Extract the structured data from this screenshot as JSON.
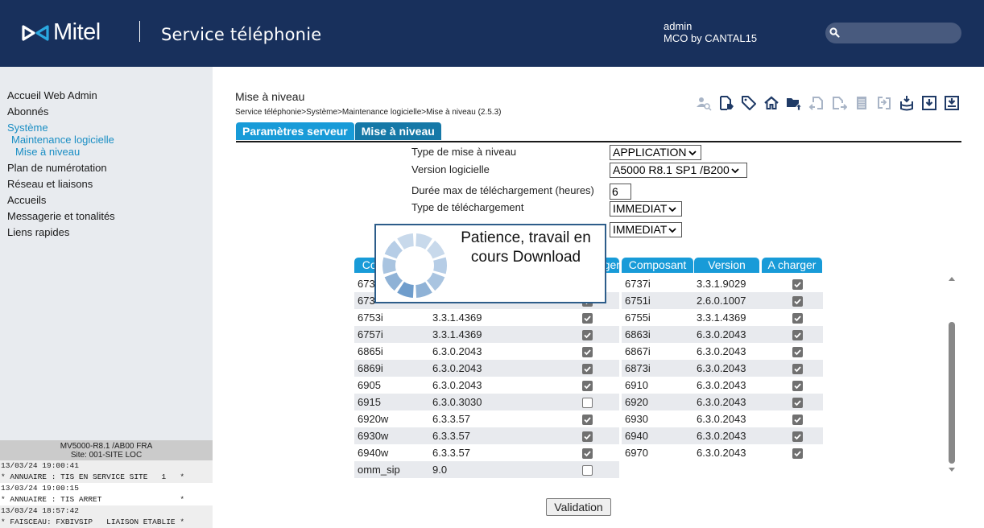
{
  "header": {
    "brand": "Mitel",
    "app_title": "Service téléphonie",
    "user": "admin",
    "site": "MCO by CANTAL15",
    "search": {
      "placeholder": "",
      "value": ""
    }
  },
  "sidebar": {
    "items": [
      {
        "label": "Accueil Web Admin",
        "level": 0,
        "active": false
      },
      {
        "label": "Abonnés",
        "level": 0,
        "active": false
      },
      {
        "label": "Système",
        "level": 0,
        "active": true
      },
      {
        "label": "Maintenance logicielle",
        "level": 1,
        "active": true
      },
      {
        "label": "Mise à niveau",
        "level": 2,
        "active": true
      },
      {
        "label": "Plan de numérotation",
        "level": 0,
        "active": false
      },
      {
        "label": "Réseau et liaisons",
        "level": 0,
        "active": false
      },
      {
        "label": "Accueils",
        "level": 0,
        "active": false
      },
      {
        "label": "Messagerie et tonalités",
        "level": 0,
        "active": false
      },
      {
        "label": "Liens rapides",
        "level": 0,
        "active": false
      }
    ],
    "status": {
      "system": "MV5000-R8.1 /AB00 FRA",
      "site": "Site: 001-SITE LOC",
      "log": [
        {
          "time": "13/03/24 19:00:41",
          "message": "* ANNUAIRE : TIS EN SERVICE SITE   1   *"
        },
        {
          "time": "13/03/24 19:00:15",
          "message": "* ANNUAIRE : TIS ARRET                 *"
        },
        {
          "time": "13/03/24 18:57:42",
          "message": "* FAISCEAU: FXBIVSIP   LIAISON ETABLIE *"
        }
      ]
    }
  },
  "page": {
    "title": "Mise à niveau",
    "breadcrumb": "Service téléphonie>Système>Maintenance logicielle>Mise à niveau (2.5.3)",
    "toolbar": [
      {
        "icon": "user-search-icon",
        "enabled": false
      },
      {
        "icon": "document-tag-icon",
        "enabled": true
      },
      {
        "icon": "tag-icon",
        "enabled": true
      },
      {
        "icon": "home-icon",
        "enabled": true
      },
      {
        "icon": "folder-upload-icon",
        "enabled": true
      },
      {
        "icon": "document-import-icon",
        "enabled": false
      },
      {
        "icon": "document-export-icon",
        "enabled": false
      },
      {
        "icon": "list-icon",
        "enabled": false
      },
      {
        "icon": "swap-icon",
        "enabled": false
      },
      {
        "icon": "database-download-icon",
        "enabled": true
      },
      {
        "icon": "download-box-icon",
        "enabled": true
      },
      {
        "icon": "save-download-icon",
        "enabled": true
      }
    ],
    "tabs": [
      {
        "label": "Paramètres serveur",
        "active": false
      },
      {
        "label": "Mise à niveau",
        "active": true
      }
    ],
    "form": {
      "upgrade_type_label": "Type de mise à niveau",
      "upgrade_type_value": "APPLICATION",
      "software_version_label": "Version logicielle",
      "software_version_value": "A5000 R8.1 SP1 /B200",
      "max_duration_label": "Durée max de téléchargement (heures)",
      "max_duration_value": "6",
      "download_type_label": "Type de téléchargement",
      "download_type_value": "IMMEDIAT",
      "activation_type_value": "IMMEDIAT"
    },
    "table": {
      "headers": [
        "Composant",
        "Version",
        "A charger"
      ],
      "left_header_visible": [
        "Co",
        "er"
      ],
      "left_rows": [
        {
          "component": "673",
          "version": "",
          "checked": true
        },
        {
          "component": "673",
          "version": "",
          "checked": true
        },
        {
          "component": "6753i",
          "version": "3.3.1.4369",
          "checked": true
        },
        {
          "component": "6757i",
          "version": "3.3.1.4369",
          "checked": true
        },
        {
          "component": "6865i",
          "version": "6.3.0.2043",
          "checked": true
        },
        {
          "component": "6869i",
          "version": "6.3.0.2043",
          "checked": true
        },
        {
          "component": "6905",
          "version": "6.3.0.2043",
          "checked": true
        },
        {
          "component": "6915",
          "version": "6.3.0.3030",
          "checked": false
        },
        {
          "component": "6920w",
          "version": "6.3.3.57",
          "checked": true
        },
        {
          "component": "6930w",
          "version": "6.3.3.57",
          "checked": true
        },
        {
          "component": "6940w",
          "version": "6.3.3.57",
          "checked": true
        },
        {
          "component": "omm_sip",
          "version": "9.0",
          "checked": false
        }
      ],
      "right_rows": [
        {
          "component": "6737i",
          "version": "3.3.1.9029",
          "checked": true
        },
        {
          "component": "6751i",
          "version": "2.6.0.1007",
          "checked": true
        },
        {
          "component": "6755i",
          "version": "3.3.1.4369",
          "checked": true
        },
        {
          "component": "6863i",
          "version": "6.3.0.2043",
          "checked": true
        },
        {
          "component": "6867i",
          "version": "6.3.0.2043",
          "checked": true
        },
        {
          "component": "6873i",
          "version": "6.3.0.2043",
          "checked": true
        },
        {
          "component": "6910",
          "version": "6.3.0.2043",
          "checked": true
        },
        {
          "component": "6920",
          "version": "6.3.0.2043",
          "checked": true
        },
        {
          "component": "6930",
          "version": "6.3.0.2043",
          "checked": true
        },
        {
          "component": "6940",
          "version": "6.3.0.2043",
          "checked": true
        },
        {
          "component": "6970",
          "version": "6.3.0.2043",
          "checked": true
        }
      ]
    },
    "validate_label": "Validation",
    "busy_dialog": {
      "message": "Patience, travail en cours Download"
    }
  },
  "colors": {
    "header_bg": "#18305c",
    "accent": "#189bd8",
    "accent_active": "#1578a7",
    "nav_active": "#1a8ec4",
    "icon_enabled": "#1f3a66",
    "icon_disabled": "#a8b4c6"
  }
}
